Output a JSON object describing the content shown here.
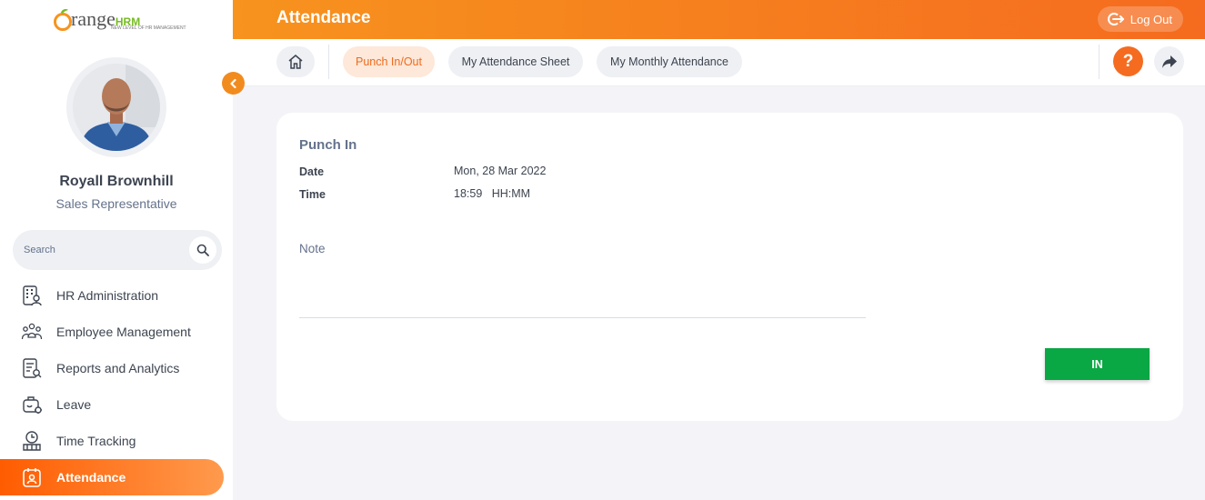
{
  "app": {
    "logo_main": "range",
    "logo_initial": "O",
    "logo_hrm": "HRM",
    "logo_tagline": "NEW LEVEL OF HR MANAGEMENT"
  },
  "user": {
    "name": "Royall Brownhill",
    "role": "Sales Representative"
  },
  "search": {
    "placeholder": "Search"
  },
  "sidebar": {
    "items": [
      {
        "label": "HR Administration",
        "icon": "building-user-icon",
        "active": false
      },
      {
        "label": "Employee Management",
        "icon": "people-icon",
        "active": false
      },
      {
        "label": "Reports and Analytics",
        "icon": "report-icon",
        "active": false
      },
      {
        "label": "Leave",
        "icon": "leave-icon",
        "active": false
      },
      {
        "label": "Time Tracking",
        "icon": "clock-icon",
        "active": false
      },
      {
        "label": "Attendance",
        "icon": "attendance-icon",
        "active": true
      }
    ]
  },
  "topbar": {
    "title": "Attendance",
    "logout_label": "Log Out"
  },
  "nav": {
    "tabs": [
      {
        "label": "Punch In/Out",
        "active": true
      },
      {
        "label": "My Attendance Sheet",
        "active": false
      },
      {
        "label": "My Monthly Attendance",
        "active": false
      }
    ],
    "help_label": "?"
  },
  "punch": {
    "title": "Punch In",
    "date_label": "Date",
    "date_value": "Mon, 28 Mar 2022",
    "time_label": "Time",
    "time_value": "18:59",
    "time_format": "HH:MM",
    "note_label": "Note",
    "note_value": "",
    "button_label": "IN"
  },
  "colors": {
    "accent": "#f56b1f",
    "accent_light": "#f7931e",
    "success": "#0aa745",
    "logo_green": "#76bc21"
  }
}
